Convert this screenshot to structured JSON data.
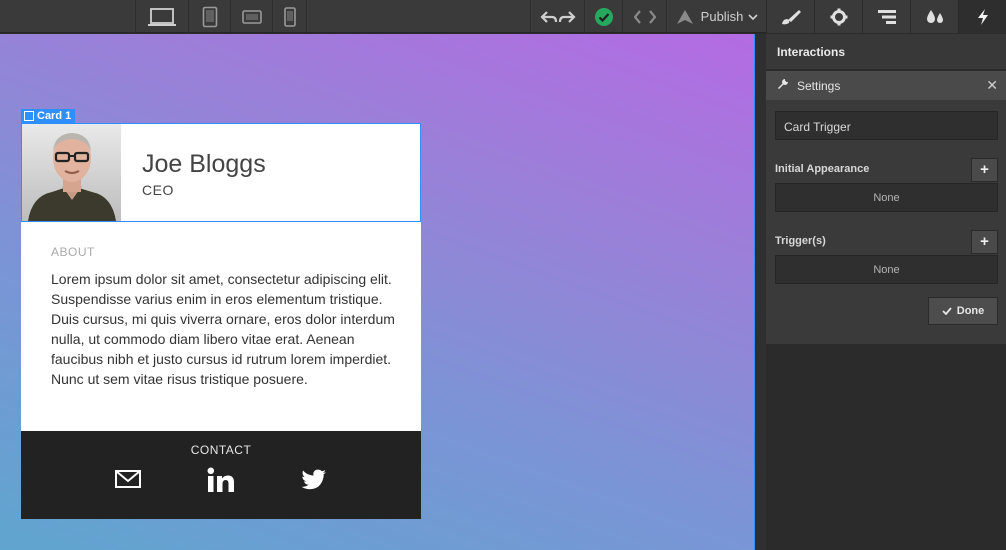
{
  "toolbar": {
    "publish_label": "Publish",
    "accent_check": "#27a85f"
  },
  "card": {
    "selection_label": "Card 1",
    "name": "Joe Bloggs",
    "role": "CEO",
    "about_heading": "ABOUT",
    "about_text": "Lorem ipsum dolor sit amet, consectetur adipiscing elit. Suspendisse varius enim in eros elementum tristique. Duis cursus, mi quis viverra ornare, eros dolor interdum nulla, ut commodo diam libero vitae erat. Aenean faucibus nibh et justo cursus id rutrum lorem imperdiet. Nunc ut sem vitae risus tristique posuere.",
    "contact_heading": "CONTACT",
    "contact_icons": [
      "mail-icon",
      "linkedin-icon",
      "twitter-icon"
    ]
  },
  "panel": {
    "title": "Interactions",
    "settings_label": "Settings",
    "interaction_name": "Card Trigger",
    "initial_appearance_label": "Initial Appearance",
    "initial_appearance_value": "None",
    "triggers_label": "Trigger(s)",
    "triggers_value": "None",
    "done_label": "Done",
    "plus_label": "+",
    "close_label": "✕"
  },
  "colors": {
    "selection": "#2f8fff",
    "panel_bg": "#3a3a3a"
  }
}
